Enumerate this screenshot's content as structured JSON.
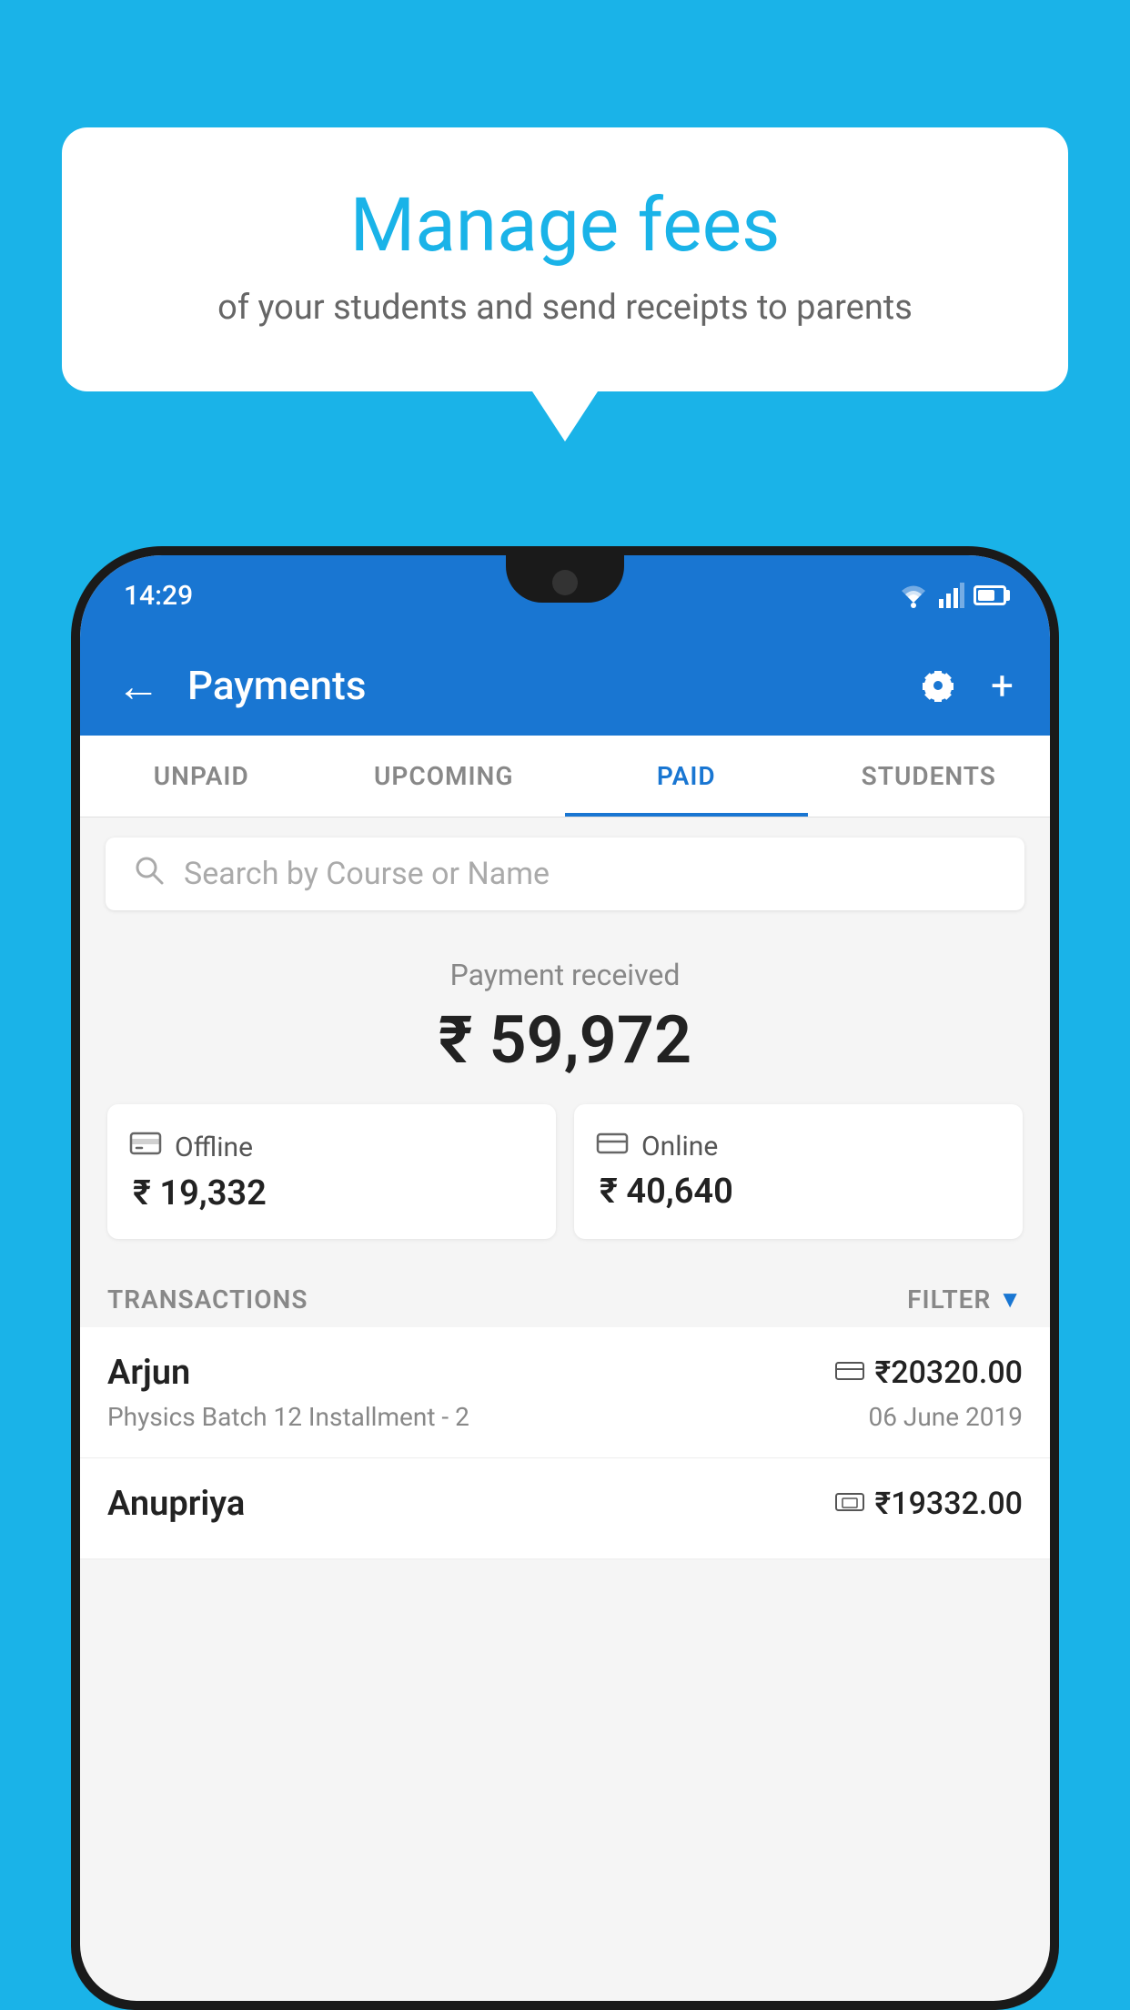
{
  "background_color": "#1ab3e8",
  "speech_bubble": {
    "title": "Manage fees",
    "subtitle": "of your students and send receipts to parents"
  },
  "status_bar": {
    "time": "14:29",
    "wifi_icon": "wifi",
    "signal_icon": "signal",
    "battery_icon": "battery"
  },
  "header": {
    "title": "Payments",
    "back_icon": "←",
    "settings_icon": "gear",
    "add_icon": "+"
  },
  "tabs": [
    {
      "label": "UNPAID",
      "active": false
    },
    {
      "label": "UPCOMING",
      "active": false
    },
    {
      "label": "PAID",
      "active": true
    },
    {
      "label": "STUDENTS",
      "active": false
    }
  ],
  "search": {
    "placeholder": "Search by Course or Name",
    "icon": "search"
  },
  "payment_summary": {
    "label": "Payment received",
    "amount": "₹ 59,972",
    "offline": {
      "icon": "offline-payment",
      "label": "Offline",
      "amount": "₹ 19,332"
    },
    "online": {
      "icon": "online-payment",
      "label": "Online",
      "amount": "₹ 40,640"
    }
  },
  "transactions_header": {
    "label": "TRANSACTIONS",
    "filter_label": "FILTER",
    "filter_icon": "filter"
  },
  "transactions": [
    {
      "name": "Arjun",
      "payment_mode_icon": "card",
      "amount": "₹20320.00",
      "course": "Physics Batch 12 Installment - 2",
      "date": "06 June 2019"
    },
    {
      "name": "Anupriya",
      "payment_mode_icon": "cash",
      "amount": "₹19332.00",
      "course": "",
      "date": ""
    }
  ]
}
